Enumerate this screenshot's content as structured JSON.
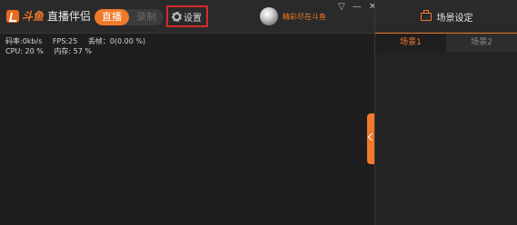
{
  "header": {
    "logo_text": "斗鱼",
    "app_name": "直播伴侣",
    "mode_live": "直播",
    "mode_record": "录制",
    "settings_label": "设置",
    "user_name": "精彩尽在斗鱼"
  },
  "window_controls": {
    "dropdown": "▽",
    "minimize": "—",
    "close": "✕"
  },
  "stats": {
    "bitrate": "码率:0kb/s",
    "fps": "FPS:25",
    "dropped": "丢帧：0(0.00 %)",
    "cpu": "CPU: 20 %",
    "memory": "内存: 57 %"
  },
  "scene_panel": {
    "title": "场景设定",
    "tabs": [
      {
        "label": "场景1",
        "active": true
      },
      {
        "label": "场景2",
        "active": false
      }
    ]
  },
  "colors": {
    "accent": "#f07a2a",
    "highlight_border": "#d42a2a",
    "background": "#1e1e1e"
  },
  "icons": {
    "settings": "gear-icon",
    "scene": "scene-icon",
    "collapse": "chevron-left-icon"
  }
}
